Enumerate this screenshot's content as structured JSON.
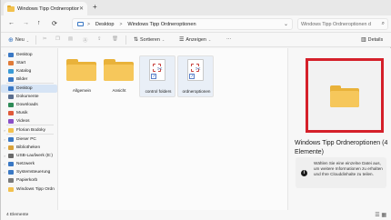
{
  "window": {
    "tab_title": "Windows Tipp Ordneroptionen",
    "tab_close": "✕",
    "new_tab": "+"
  },
  "address": {
    "back": "←",
    "forward": "→",
    "up": "↑",
    "refresh": "⟳",
    "crumb_chevron": ">",
    "crumbs": [
      "Desktop",
      "Windows Tipp Ordneroptionen"
    ],
    "expand": "⌄",
    "search_placeholder": "Windows Tipp Ordneroptionen d",
    "search_icon": "⌕"
  },
  "toolbar": {
    "new_label": "Neu",
    "sort_label": "Sortieren",
    "view_label": "Anzeigen",
    "more": "···",
    "details_label": "Details",
    "icons": [
      "cut-icon",
      "copy-icon",
      "paste-icon",
      "rename-icon",
      "share-icon",
      "delete-icon"
    ]
  },
  "sidebar": {
    "items": [
      {
        "label": "Desktop",
        "icon": "desktop-icon",
        "color": "#3a78c4"
      },
      {
        "label": "Start",
        "icon": "home-icon",
        "color": "#e07b39"
      },
      {
        "label": "Katalog",
        "icon": "gallery-icon",
        "color": "#3a9bd6"
      },
      {
        "label": "Bilder",
        "icon": "pictures-icon",
        "color": "#3a78c4"
      },
      {
        "label": "Desktop",
        "icon": "desktop-icon",
        "color": "#3a78c4",
        "selected": true
      },
      {
        "label": "Dokumente",
        "icon": "documents-icon",
        "color": "#5b6f8f"
      },
      {
        "label": "Downloads",
        "icon": "downloads-icon",
        "color": "#2e8b57"
      },
      {
        "label": "Musik",
        "icon": "music-icon",
        "color": "#e05a3a"
      },
      {
        "label": "Videos",
        "icon": "videos-icon",
        "color": "#8a4fc7"
      },
      {
        "label": "Florian Bodoky",
        "icon": "user-folder-icon",
        "color": "#f2c14e"
      },
      {
        "label": "Dieser PC",
        "icon": "pc-icon",
        "color": "#3a78c4"
      },
      {
        "label": "Bibliotheken",
        "icon": "libraries-icon",
        "color": "#d9a23a"
      },
      {
        "label": "USB-Laufwerk (E:)",
        "icon": "usb-drive-icon",
        "color": "#6a6a6a"
      },
      {
        "label": "Netzwerk",
        "icon": "network-icon",
        "color": "#3a78c4"
      },
      {
        "label": "Systemsteuerung",
        "icon": "control-panel-icon",
        "color": "#3a78c4"
      },
      {
        "label": "Papierkorb",
        "icon": "recycle-bin-icon",
        "color": "#7a7a7a"
      },
      {
        "label": "Windows Tipp Ordn",
        "icon": "folder-icon",
        "color": "#f2c14e"
      }
    ]
  },
  "files": [
    {
      "name": "Allgemein",
      "icon": "folder-icon"
    },
    {
      "name": "Ansicht",
      "icon": "folder-icon"
    },
    {
      "name": "control folders",
      "icon": "shortcut-icon"
    },
    {
      "name": "ordneroptionen",
      "icon": "shortcut-icon"
    }
  ],
  "details": {
    "title": "Windows Tipp Ordneroptionen (4 Elemente)",
    "info_text": "Wählen Sie eine einzelne Datei aus, um weitere Informationen zu erhalten und Ihre Clouddinhalte zu teilen.",
    "info_icon": "i",
    "highlight_color": "#d5202a"
  },
  "status": {
    "count": "4 Elemente",
    "view_icons": "☰ ▦"
  }
}
